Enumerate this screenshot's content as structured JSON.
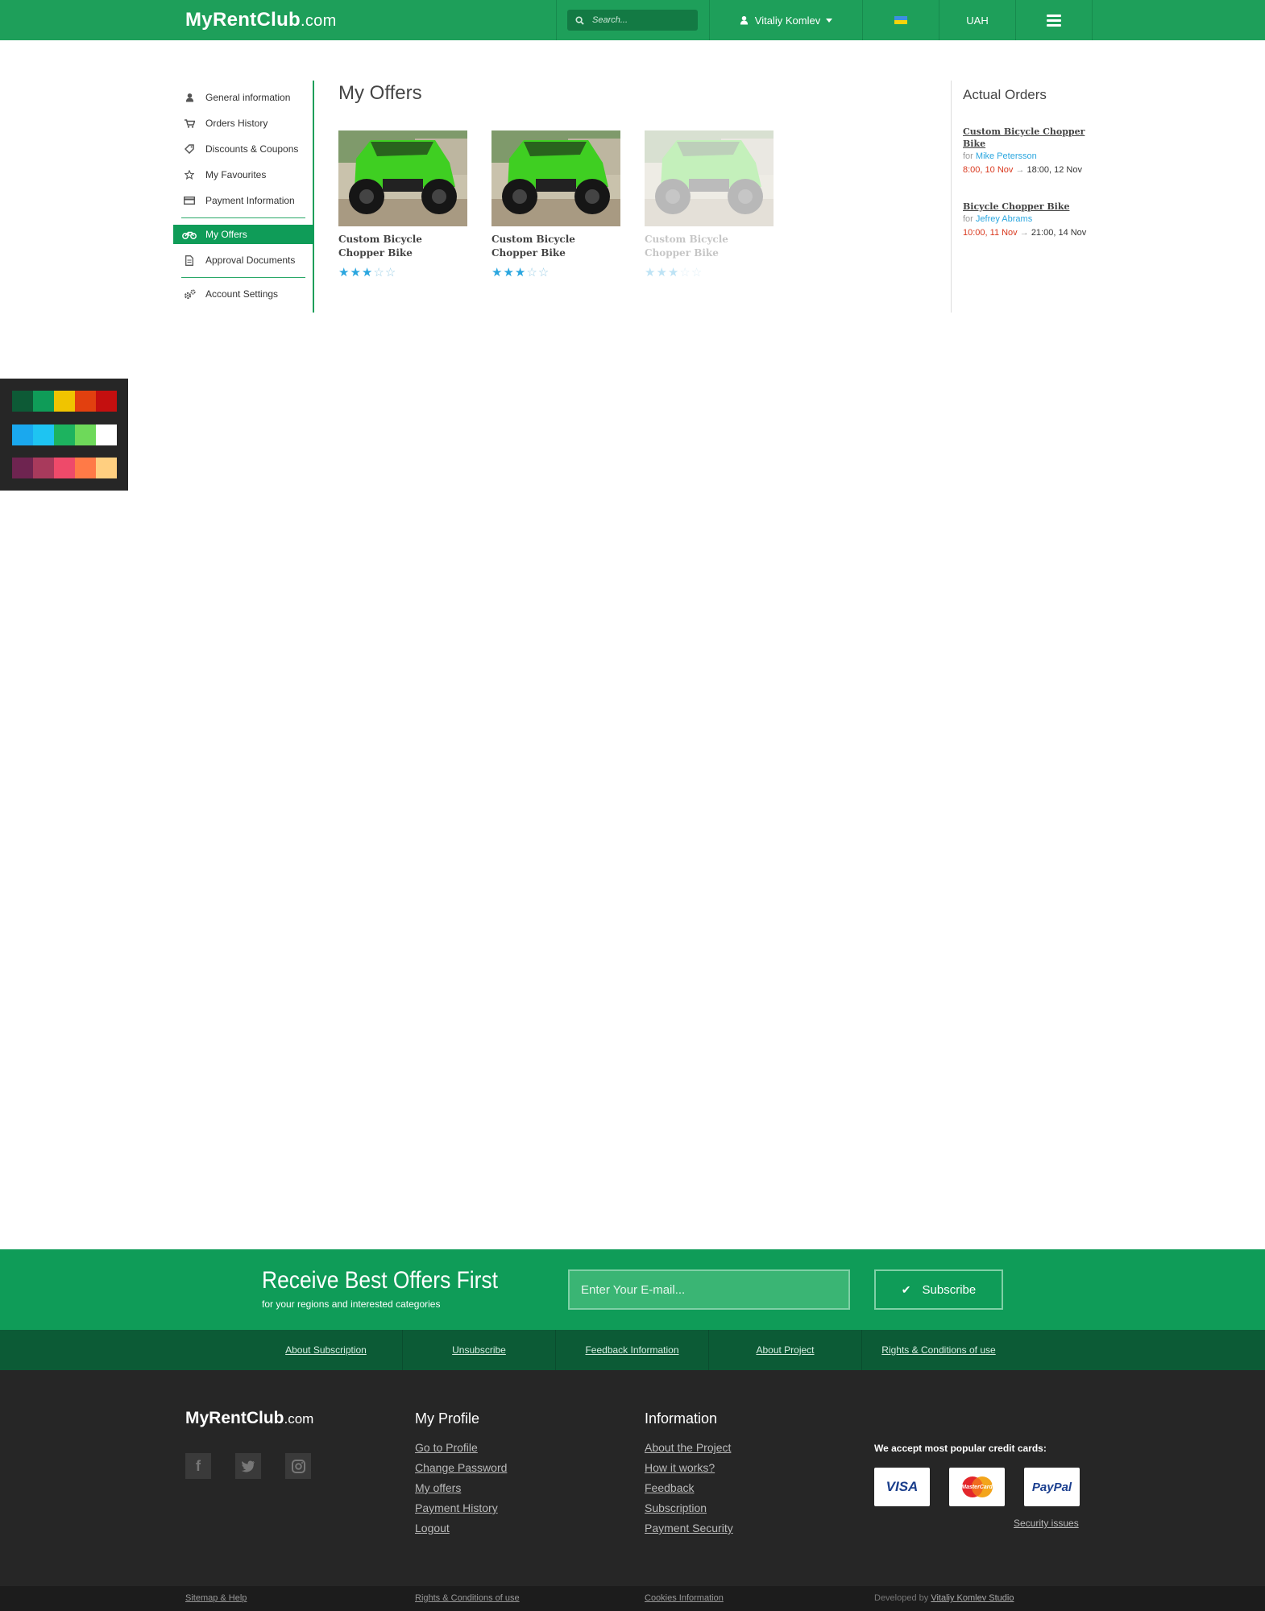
{
  "header": {
    "logo_main": "MyRentClub",
    "logo_domain": ".com",
    "search_placeholder": "Search...",
    "user_name": "Vitaliy Komlev",
    "currency": "UAH"
  },
  "sidebar": {
    "items": [
      {
        "label": "General information",
        "icon": "user-icon"
      },
      {
        "label": "Orders History",
        "icon": "cart-icon"
      },
      {
        "label": "Discounts & Coupons",
        "icon": "tag-icon"
      },
      {
        "label": "My Favourites",
        "icon": "star-icon"
      },
      {
        "label": "Payment Information",
        "icon": "credit-card-icon"
      },
      {
        "label": "My Offers",
        "icon": "bike-icon",
        "active": true
      },
      {
        "label": "Approval Documents",
        "icon": "document-icon"
      },
      {
        "label": "Account Settings",
        "icon": "gears-icon"
      }
    ]
  },
  "main": {
    "title": "My Offers",
    "offers": [
      {
        "title": "Custom Bicycle Chopper Bike",
        "rating": 3,
        "max": 5,
        "active": true
      },
      {
        "title": "Custom Bicycle Chopper Bike",
        "rating": 3,
        "max": 5,
        "active": true
      },
      {
        "title": "Custom Bicycle Chopper Bike",
        "rating": 3,
        "max": 5,
        "active": false
      }
    ]
  },
  "orders": {
    "title": "Actual Orders",
    "items": [
      {
        "title": "Custom Bicycle Chopper Bike",
        "for_label": "for",
        "customer": "Mike Petersson",
        "from": "8:00, 10 Nov",
        "arrow": "→",
        "to": "18:00, 12 Nov"
      },
      {
        "title": "Bicycle Chopper Bike",
        "for_label": "for",
        "customer": "Jefrey Abrams",
        "from": "10:00, 11 Nov",
        "arrow": "→",
        "to": "21:00, 14 Nov"
      }
    ]
  },
  "palette": {
    "rows": [
      [
        "#0d5a36",
        "#0f9c58",
        "#f0c400",
        "#e2400f",
        "#c40f0f"
      ],
      [
        "#1aa8ee",
        "#1ec4f2",
        "#1db35f",
        "#6ed95a",
        "#ffffff"
      ],
      [
        "#6e2450",
        "#a83a5c",
        "#ee4a6a",
        "#ff7a47",
        "#ffcf80"
      ]
    ]
  },
  "subscribe": {
    "title": "Receive Best Offers First",
    "subtitle": "for your regions and interested categories",
    "email_placeholder": "Enter Your E-mail...",
    "button_label": "Subscribe"
  },
  "links_bar": [
    "About Subscription",
    "Unsubscribe",
    "Feedback Information",
    "About Project",
    "Rights & Conditions of use"
  ],
  "footer": {
    "logo_main": "MyRentClub",
    "logo_domain": ".com",
    "profile": {
      "title": "My Profile",
      "links": [
        "Go to Profile",
        "Change Password",
        "My offers",
        "Payment History",
        "Logout"
      ]
    },
    "information": {
      "title": "Information",
      "links": [
        "About the Project",
        "How it works?",
        "Feedback",
        "Subscription",
        "Payment Security"
      ]
    },
    "cards_title": "We accept most popular credit cards:",
    "cards": [
      "VISA",
      "MasterCard",
      "PayPal"
    ],
    "security": "Security issues"
  },
  "bottom": {
    "sitemap": "Sitemap & Help",
    "rights": "Rights & Conditions of use",
    "cookies": "Cookies Information",
    "dev_prefix": "Developed by",
    "dev_link": "Vitaliy Komlev Studio"
  },
  "colors": {
    "brand": "#1e9f5a",
    "brand_dark": "#0c5b36",
    "accent_blue": "#2aa6df",
    "date_red": "#d9381e",
    "footer_bg": "#262626"
  }
}
